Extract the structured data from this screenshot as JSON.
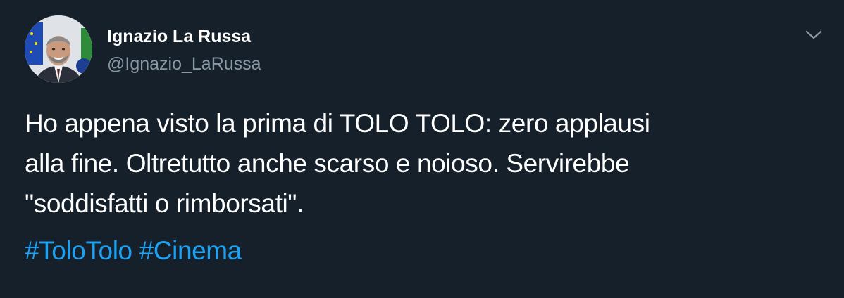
{
  "user": {
    "name": "Ignazio La Russa",
    "handle": "@Ignazio_LaRussa",
    "avatar_icon": "profile-photo"
  },
  "tweet": {
    "lines": [
      "Ho appena visto la prima di TOLO TOLO: zero applausi",
      "alla fine. Oltretutto anche scarso e noioso. Servirebbe",
      "\"soddisfatti o rimborsati\"."
    ],
    "hashtags": [
      "#ToloTolo",
      "#Cinema"
    ]
  },
  "menu": {
    "icon": "chevron-down-icon"
  },
  "colors": {
    "background": "#15202b",
    "text": "#ffffff",
    "secondary_text": "#8899a6",
    "link": "#1da1f2"
  }
}
